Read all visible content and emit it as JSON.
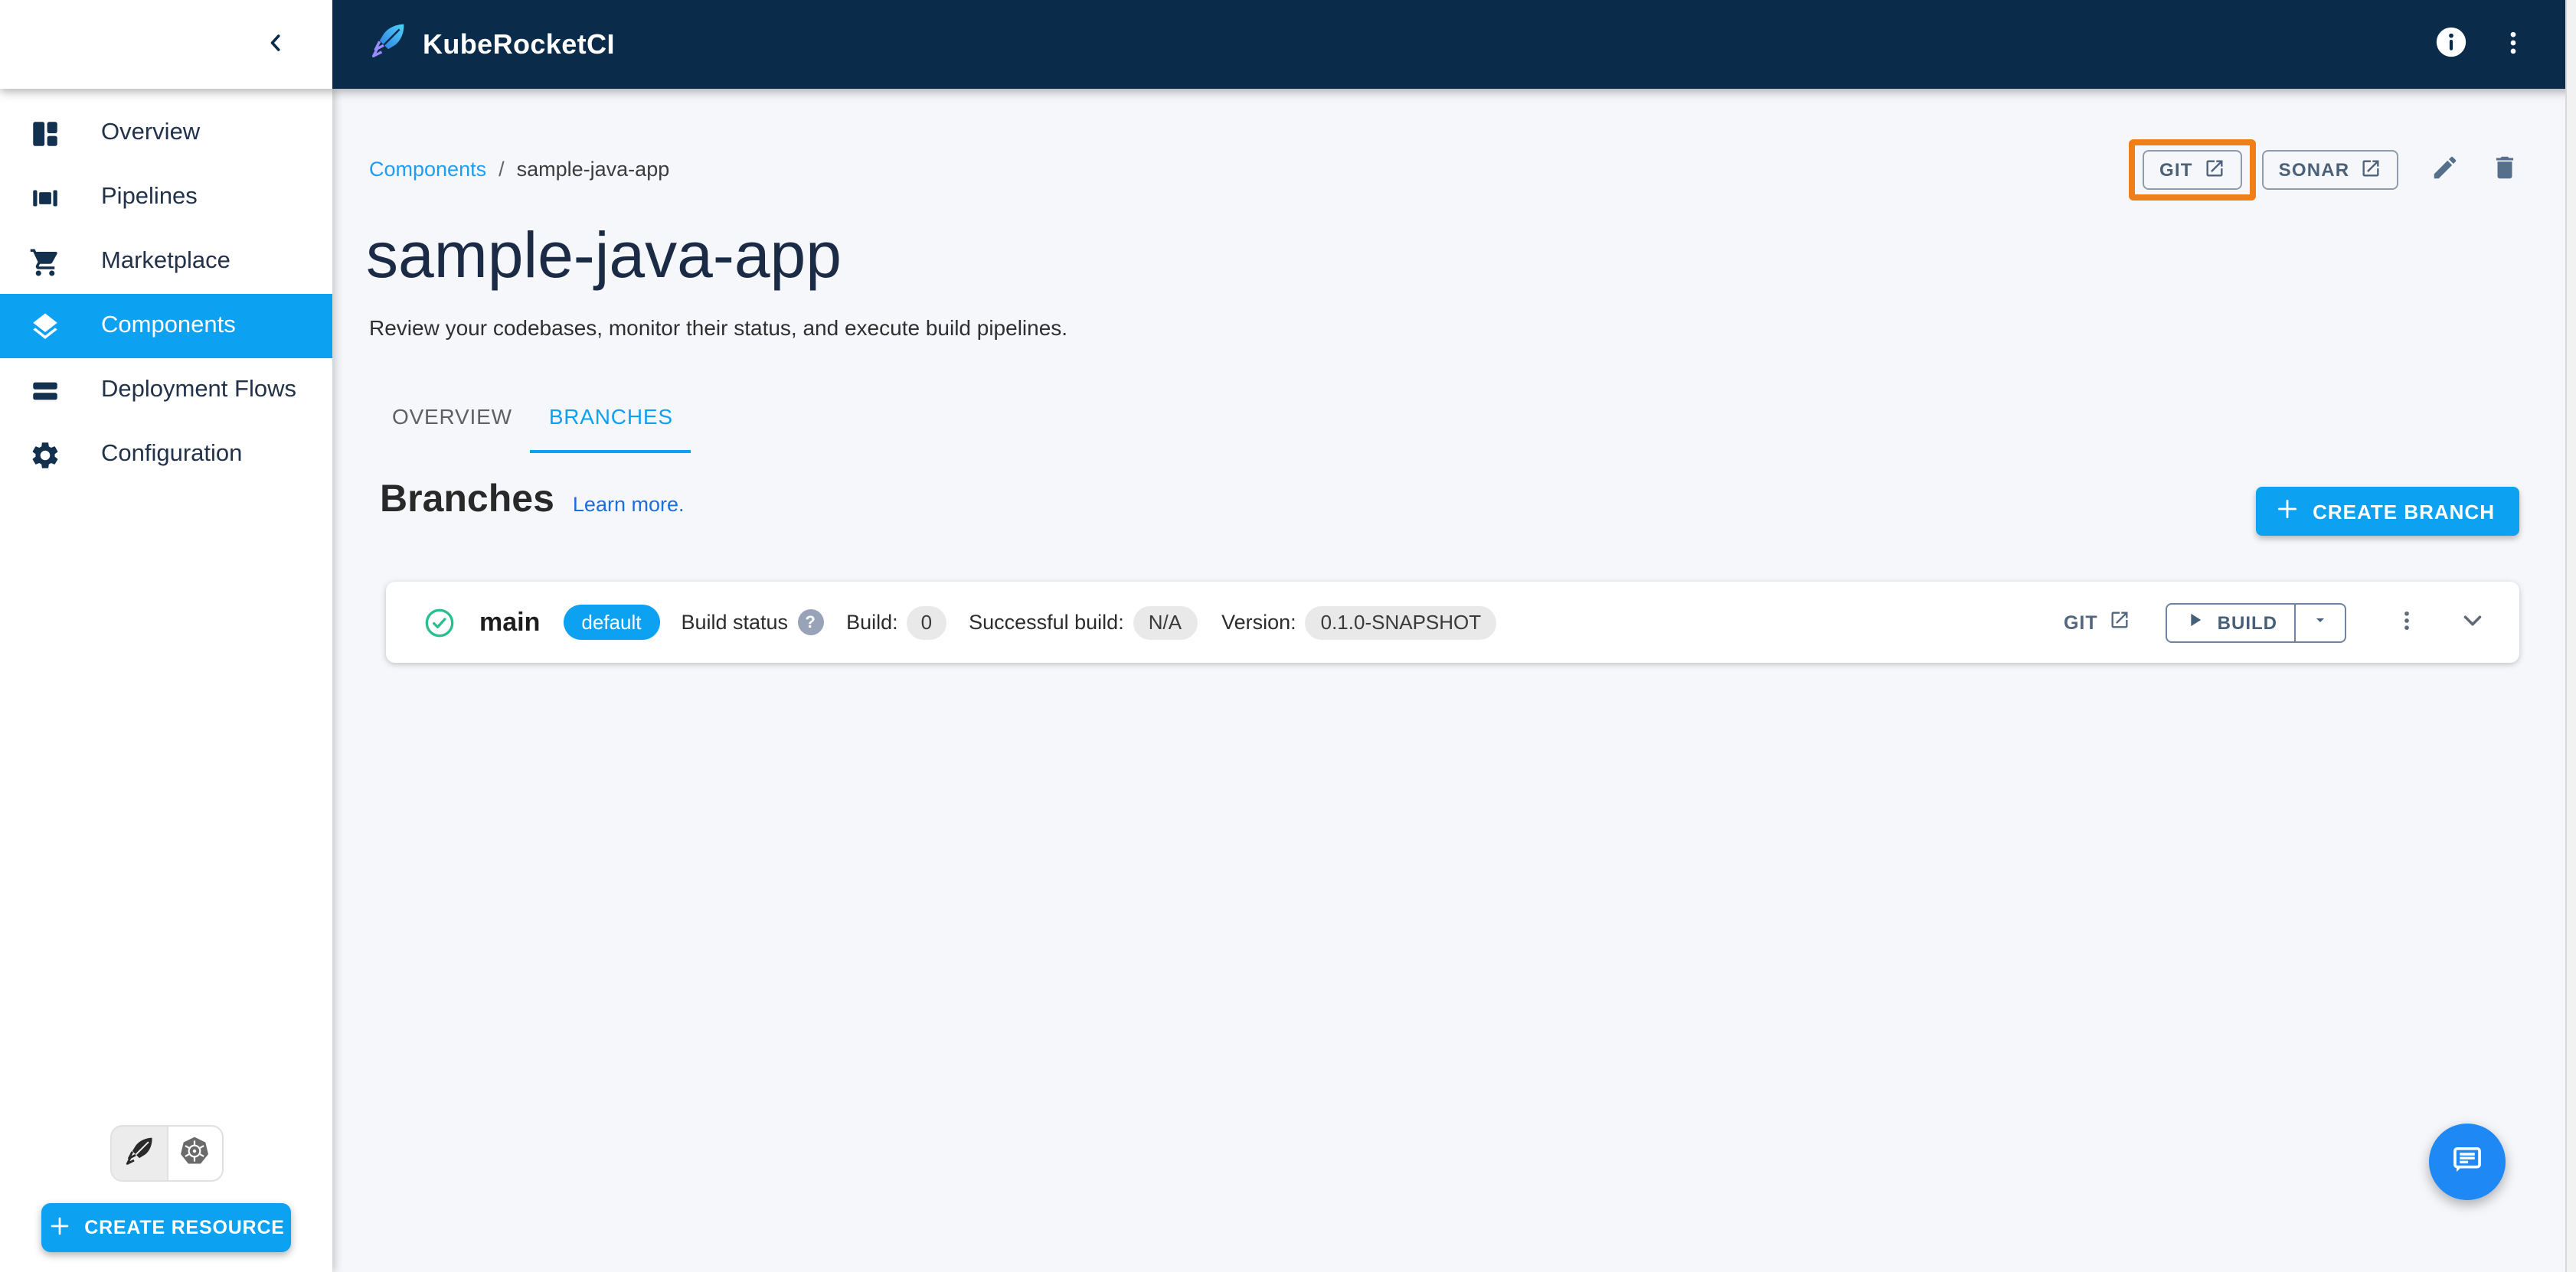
{
  "app": {
    "title": "KubeRocketCI"
  },
  "colors": {
    "accent": "#0da1f2",
    "header_navy": "#0b2b4a",
    "annotation_orange": "#ef8019",
    "status_green": "#2abd92",
    "link_blue": "#1a6fd9",
    "slate": "#4b617a",
    "fab_blue": "#1e88f5"
  },
  "sidebar": {
    "items": [
      {
        "label": "Overview"
      },
      {
        "label": "Pipelines"
      },
      {
        "label": "Marketplace"
      },
      {
        "label": "Components",
        "selected": true
      },
      {
        "label": "Deployment Flows"
      },
      {
        "label": "Configuration"
      }
    ],
    "create_resource_label": "CREATE RESOURCE"
  },
  "breadcrumb": {
    "root": "Components",
    "separator": "/",
    "current": "sample-java-app"
  },
  "page": {
    "title": "sample-java-app",
    "subtitle": "Review your codebases, monitor their status, and execute build pipelines."
  },
  "top_actions": {
    "git_label": "GIT",
    "sonar_label": "SONAR"
  },
  "tabs": [
    {
      "label": "OVERVIEW",
      "active": false
    },
    {
      "label": "BRANCHES",
      "active": true
    }
  ],
  "section": {
    "title": "Branches",
    "learn_more": "Learn more.",
    "create_branch_label": "CREATE BRANCH"
  },
  "branch_row": {
    "name": "main",
    "default_chip": "default",
    "build_status_label": "Build status",
    "help_glyph": "?",
    "build_label": "Build:",
    "build_count": "0",
    "successful_build_label": "Successful build:",
    "successful_build_value": "N/A",
    "version_label": "Version:",
    "version_value": "0.1.0-SNAPSHOT",
    "git_label": "GIT",
    "build_button_label": "BUILD"
  }
}
